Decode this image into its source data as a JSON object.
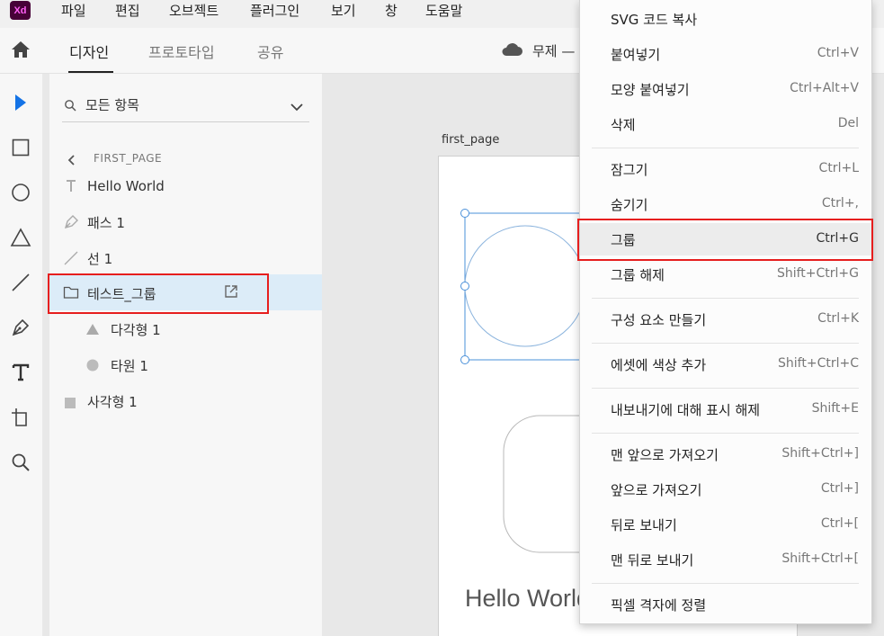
{
  "app": {
    "logo": "Xd"
  },
  "menubar": {
    "items": [
      "파일",
      "편집",
      "오브젝트",
      "플러그인",
      "보기",
      "창",
      "도움말"
    ]
  },
  "toolbar": {
    "tabs": [
      "디자인",
      "프로토타입",
      "공유"
    ],
    "active_tab": "디자인",
    "doc_title": "무제 —"
  },
  "tools": [
    "select-tool",
    "rectangle-tool",
    "ellipse-tool",
    "polygon-tool",
    "line-tool",
    "pen-tool",
    "text-tool",
    "artboard-tool",
    "zoom-tool"
  ],
  "layers": {
    "search": {
      "label": "모든 항목"
    },
    "breadcrumb": "FIRST_PAGE",
    "items": [
      {
        "label": "Hello World",
        "icon": "text-icon"
      },
      {
        "label": "패스 1",
        "icon": "pen-icon"
      },
      {
        "label": "선 1",
        "icon": "line-icon"
      },
      {
        "label": "테스트_그룹",
        "icon": "folder-icon",
        "selected": true
      },
      {
        "label": "다각형 1",
        "icon": "triangle-icon"
      },
      {
        "label": "타원 1",
        "icon": "circle-icon"
      },
      {
        "label": "사각형 1",
        "icon": "square-icon"
      }
    ]
  },
  "canvas": {
    "artboard_name": "first_page",
    "text": "Hello World"
  },
  "context_menu": {
    "items": [
      {
        "label": "SVG 코드 복사",
        "shortcut": ""
      },
      {
        "label": "붙여넣기",
        "shortcut": "Ctrl+V"
      },
      {
        "label": "모양 붙여넣기",
        "shortcut": "Ctrl+Alt+V"
      },
      {
        "label": "삭제",
        "shortcut": "Del"
      },
      {
        "label": "잠그기",
        "shortcut": "Ctrl+L"
      },
      {
        "label": "숨기기",
        "shortcut": "Ctrl+,"
      },
      {
        "label": "그룹",
        "shortcut": "Ctrl+G",
        "highlighted": true
      },
      {
        "label": "그룹 해제",
        "shortcut": "Shift+Ctrl+G"
      },
      {
        "label": "구성 요소 만들기",
        "shortcut": "Ctrl+K"
      },
      {
        "label": "에셋에 색상 추가",
        "shortcut": "Shift+Ctrl+C"
      },
      {
        "label": "내보내기에 대해 표시 해제",
        "shortcut": "Shift+E"
      },
      {
        "label": "맨 앞으로 가져오기",
        "shortcut": "Shift+Ctrl+]"
      },
      {
        "label": "앞으로 가져오기",
        "shortcut": "Ctrl+]"
      },
      {
        "label": "뒤로 보내기",
        "shortcut": "Ctrl+["
      },
      {
        "label": "맨 뒤로 보내기",
        "shortcut": "Shift+Ctrl+["
      },
      {
        "label": "픽셀 격자에 정렬",
        "shortcut": ""
      }
    ]
  },
  "colors": {
    "accent": "#1473e6",
    "highlight_box": "#e61e1e",
    "selected_layer": "#dcecf8",
    "logo_bg": "#470137",
    "logo_fg": "#ff61f6"
  }
}
